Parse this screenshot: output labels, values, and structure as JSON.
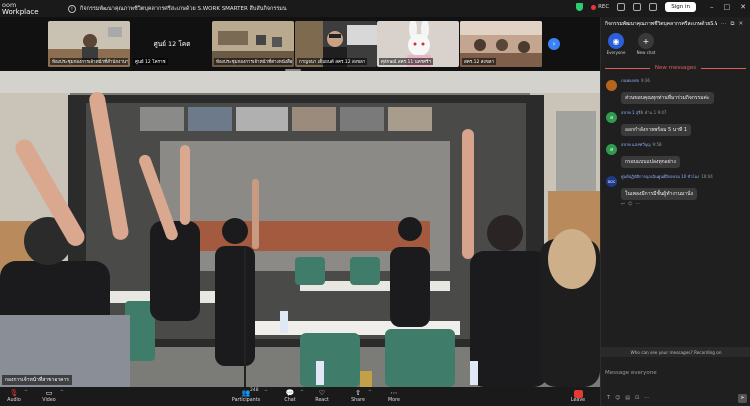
{
  "app": {
    "brand_line1": "oom",
    "brand_line2": "Workplace",
    "meeting_title": "กิจกรรมพัฒนาคุณภาพชีวิตบุคลากรศรีสะเกษด้วย S.WORK SMARTER สืบสันกิจกรรมน",
    "recording_label": "REC",
    "signin_label": "Sign in",
    "colors": {
      "accent": "#3b82f6",
      "record": "#e53935",
      "shield": "#2ecc71",
      "new_messages": "#e25b5b"
    }
  },
  "thumbnails": [
    {
      "name": "ห้องประชุมกองการเจ้าหน้าที่สำนักงานฯ",
      "center": ""
    },
    {
      "name": "ศูนย์ 12 โคราช",
      "center": "ศูนย์ 12 โคต"
    },
    {
      "name": "ห้องประชุมกองการเจ้าหน้าที่ต่างหนังสือ",
      "center": ""
    },
    {
      "name": "กาญจนา เต็มยนต์ สคร.12 สงขลา",
      "center": ""
    },
    {
      "name": "ศุลักษณ์ สคร.11 นครศรีฯ",
      "center": ""
    },
    {
      "name": "สคร.12 สงขลา",
      "center": ""
    }
  ],
  "main_video": {
    "name": "กองการเจ้าหน้าที่สาขาอาคาร"
  },
  "toolbar": {
    "audio": "Audio",
    "video": "Video",
    "participants": "Participants",
    "participants_count": "248",
    "chat": "Chat",
    "react": "React",
    "share": "Share",
    "more": "More",
    "leave": "Leave"
  },
  "chat": {
    "title": "กิจกรรมพัฒนาคุณภาพชีวิตบุคลากรศรีสะเกษด้วยS.WORK",
    "tab_everyone": "Everyone",
    "tab_new_chat": "New chat",
    "new_messages_label": "New messages",
    "messages": [
      {
        "sender": "ภนพลภศจ",
        "time": "9:36",
        "text": "ส่วนขอบคุณทุกท่านที่มาร่วมกิจกรรมค่ะ",
        "avatar_letter": "",
        "avatar_color": "#b5651d"
      },
      {
        "sender": "สลาพ 1 สุรีย์",
        "time": "ด้าน 1 9:47",
        "text": "ออกกำลังกายพร้อม 5 นาที 1",
        "avatar_letter": "ล",
        "avatar_color": "#2e9b4e"
      },
      {
        "sender": "สลาพ แสงฑวีบุญ",
        "time": "9:58",
        "text": "กรอบแบบแปลงทุกอย่าง",
        "avatar_letter": "ส",
        "avatar_color": "#2e9b4e"
      },
      {
        "sender": "ศูนย์ปฏิบัติการฉุกเฉินศูนย์ฝึกอบรม 10 ชั่วโมง",
        "time": "10:04",
        "text": "ในเพลงมีการมีชั้นผู้ทำงานมานั่ง",
        "avatar_letter": "DDC",
        "avatar_color": "#1e3a8a"
      }
    ],
    "who_can_see": "Who can see your messages? Recording on",
    "input_placeholder": "Message everyone"
  }
}
